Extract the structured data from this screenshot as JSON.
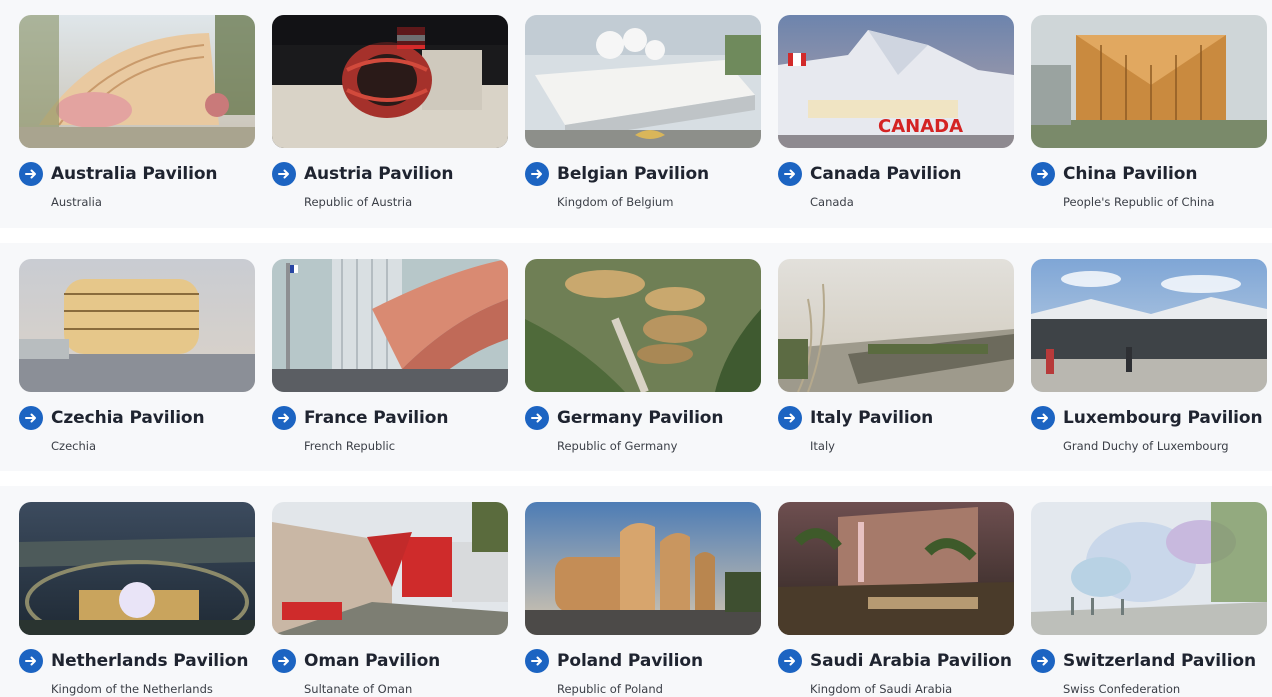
{
  "pavilions": [
    {
      "title": "Australia Pavilion",
      "subtitle": "Australia",
      "thumb_icon": "australia-pavilion-photo"
    },
    {
      "title": "Austria Pavilion",
      "subtitle": "Republic of Austria",
      "thumb_icon": "austria-pavilion-photo"
    },
    {
      "title": "Belgian Pavilion",
      "subtitle": "Kingdom of Belgium",
      "thumb_icon": "belgian-pavilion-photo"
    },
    {
      "title": "Canada Pavilion",
      "subtitle": "Canada",
      "thumb_icon": "canada-pavilion-photo",
      "thumb_text": "CANADA"
    },
    {
      "title": "China Pavilion",
      "subtitle": "People's Republic of China",
      "thumb_icon": "china-pavilion-photo"
    },
    {
      "title": "Czechia Pavilion",
      "subtitle": "Czechia",
      "thumb_icon": "czechia-pavilion-photo"
    },
    {
      "title": "France Pavilion",
      "subtitle": "French Republic",
      "thumb_icon": "france-pavilion-photo"
    },
    {
      "title": "Germany Pavilion",
      "subtitle": "Republic of Germany",
      "thumb_icon": "germany-pavilion-photo"
    },
    {
      "title": "Italy Pavilion",
      "subtitle": "Italy",
      "thumb_icon": "italy-pavilion-photo"
    },
    {
      "title": "Luxembourg Pavilion",
      "subtitle": "Grand Duchy of Luxembourg",
      "thumb_icon": "luxembourg-pavilion-photo"
    },
    {
      "title": "Netherlands Pavilion",
      "subtitle": "Kingdom of the Netherlands",
      "thumb_icon": "netherlands-pavilion-photo"
    },
    {
      "title": "Oman Pavilion",
      "subtitle": "Sultanate of Oman",
      "thumb_icon": "oman-pavilion-photo"
    },
    {
      "title": "Poland Pavilion",
      "subtitle": "Republic of Poland",
      "thumb_icon": "poland-pavilion-photo"
    },
    {
      "title": "Saudi Arabia Pavilion",
      "subtitle": "Kingdom of Saudi Arabia",
      "thumb_icon": "saudi-arabia-pavilion-photo"
    },
    {
      "title": "Switzerland Pavilion",
      "subtitle": "Swiss Confederation",
      "thumb_icon": "switzerland-pavilion-photo"
    }
  ],
  "colors": {
    "accent": "#1c64c2",
    "title_text": "#1f2430",
    "subtitle_text": "#3b3f47",
    "band_background": "#f7f8fa"
  },
  "icons": {
    "link_arrow": "arrow-right-circle-icon"
  }
}
